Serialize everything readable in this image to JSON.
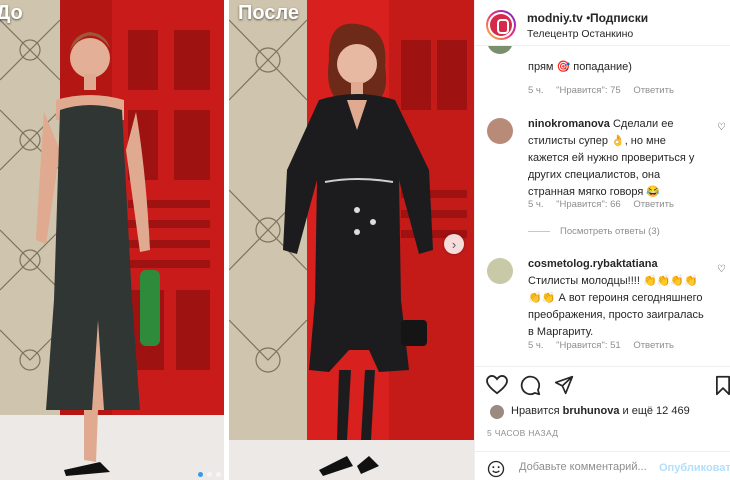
{
  "photo": {
    "label_before": "До",
    "label_after": "После",
    "carousel": {
      "dots": 3,
      "active_index": 0
    }
  },
  "header": {
    "username": "modniy.tv",
    "separator": "•",
    "follow_label": "Подписки",
    "location": "Телецентр Останкино"
  },
  "comments": [
    {
      "text": "прям 🎯 попадание)",
      "time": "5 ч.",
      "likes": "\"Нравится\": 75",
      "reply": "Ответить"
    },
    {
      "username": "ninokromanova",
      "text": "Сделали ее стилисты супер 👌, но мне кажется ей нужно провериться у других специалистов, она странная мягко говоря 😂",
      "time": "5 ч.",
      "likes": "\"Нравится\": 66",
      "reply": "Ответить",
      "view_replies": "Посмотреть ответы (3)"
    },
    {
      "username": "cosmetolog.rybaktatiana",
      "text": "Стилисты молодцы!!!! 👏👏👏👏 👏👏 А вот героиня сегодняшнего преображения, просто заигралась в Маргариту.",
      "time": "5 ч.",
      "likes": "\"Нравится\": 51",
      "reply": "Ответить"
    }
  ],
  "actions": {
    "like_icon": "heart-icon",
    "comment_icon": "comment-icon",
    "share_icon": "send-icon",
    "save_icon": "bookmark-icon"
  },
  "likes": {
    "prefix": "Нравится",
    "user": "bruhunova",
    "suffix": "и ещё 12 469"
  },
  "post_time": "5 ЧАСОВ НАЗАД",
  "add_comment": {
    "placeholder": "Добавьте комментарий...",
    "publish_label": "Опубликовать"
  },
  "colors": {
    "accent": "#3897f0",
    "publish_disabled": "#b2dffc",
    "stage_red": "#d8201e"
  }
}
